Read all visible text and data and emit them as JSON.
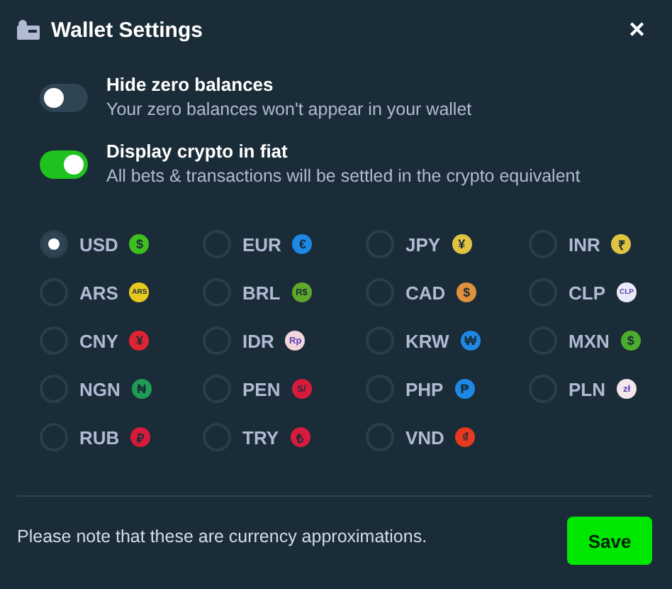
{
  "header": {
    "title": "Wallet Settings",
    "close": "✕"
  },
  "toggles": [
    {
      "label": "Hide zero balances",
      "description": "Your zero balances won't appear in your wallet",
      "on": false
    },
    {
      "label": "Display crypto in fiat",
      "description": "All bets & transactions will be settled in the crypto equivalent",
      "on": true
    }
  ],
  "currencies": [
    {
      "code": "USD",
      "symbol": "$",
      "color": "#3fbf1f",
      "selected": true
    },
    {
      "code": "EUR",
      "symbol": "€",
      "color": "#1e88e5",
      "selected": false
    },
    {
      "code": "JPY",
      "symbol": "¥",
      "color": "#e0c341",
      "selected": false
    },
    {
      "code": "INR",
      "symbol": "₹",
      "color": "#e0c341",
      "selected": false
    },
    {
      "code": "ARS",
      "symbol": "ARS",
      "color": "#e6c81e",
      "selected": false
    },
    {
      "code": "BRL",
      "symbol": "R$",
      "color": "#5fa82a",
      "selected": false
    },
    {
      "code": "CAD",
      "symbol": "$",
      "color": "#e0913a",
      "selected": false
    },
    {
      "code": "CLP",
      "symbol": "CLP",
      "color": "#e8eaf6",
      "selected": false
    },
    {
      "code": "CNY",
      "symbol": "¥",
      "color": "#e0242f",
      "selected": false
    },
    {
      "code": "IDR",
      "symbol": "Rp",
      "color": "#f2d6dc",
      "selected": false
    },
    {
      "code": "KRW",
      "symbol": "₩",
      "color": "#1e88e5",
      "selected": false
    },
    {
      "code": "MXN",
      "symbol": "$",
      "color": "#4cae2c",
      "selected": false
    },
    {
      "code": "NGN",
      "symbol": "₦",
      "color": "#1e9c55",
      "selected": false
    },
    {
      "code": "PEN",
      "symbol": "S/",
      "color": "#d81b3c",
      "selected": false
    },
    {
      "code": "PHP",
      "symbol": "₱",
      "color": "#1e88e5",
      "selected": false
    },
    {
      "code": "PLN",
      "symbol": "zł",
      "color": "#f3e5ea",
      "selected": false
    },
    {
      "code": "RUB",
      "symbol": "₽",
      "color": "#d81b3c",
      "selected": false
    },
    {
      "code": "TRY",
      "symbol": "₺",
      "color": "#d81b3c",
      "selected": false
    },
    {
      "code": "VND",
      "symbol": "₫",
      "color": "#e53920",
      "selected": false
    }
  ],
  "footer": {
    "note": "Please note that these are currency approximations.",
    "button": "Save"
  }
}
